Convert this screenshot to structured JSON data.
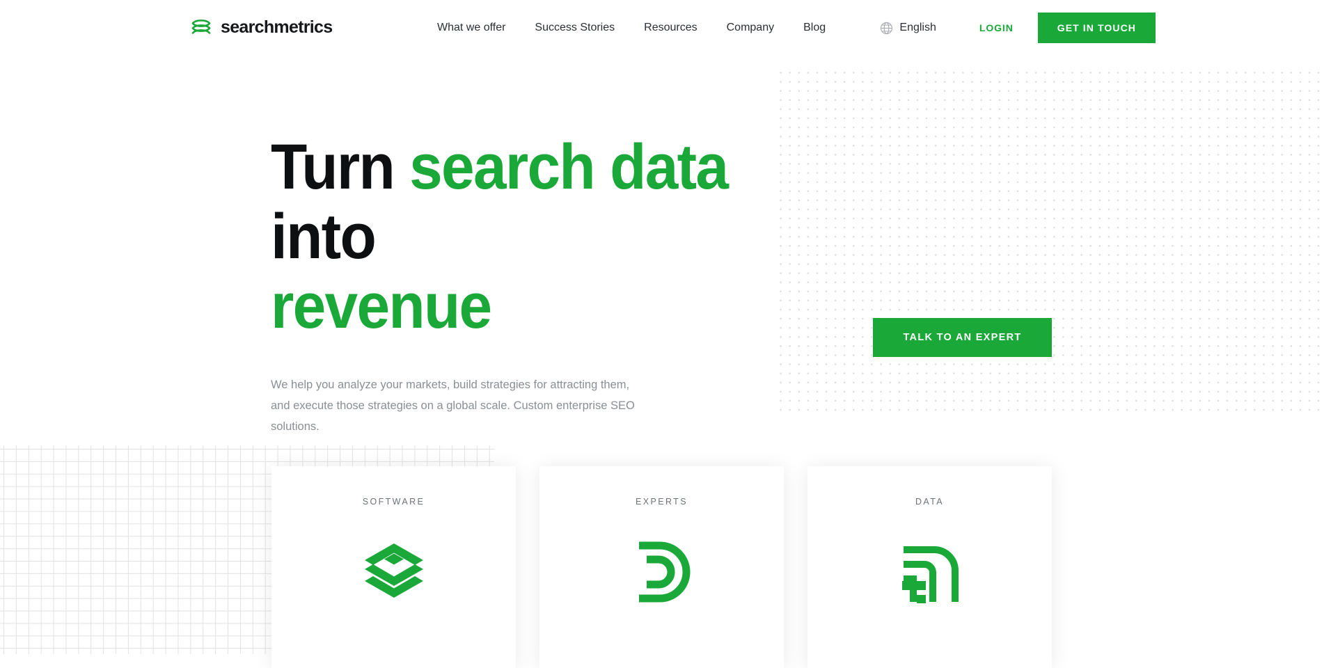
{
  "brand": {
    "name": "searchmetrics",
    "logo_icon": "stacked-layers-icon",
    "color": "#1aa838"
  },
  "header": {
    "nav_items": [
      {
        "label": "What we offer"
      },
      {
        "label": "Success Stories"
      },
      {
        "label": "Resources"
      },
      {
        "label": "Company"
      },
      {
        "label": "Blog"
      }
    ],
    "language": {
      "label": "English",
      "icon": "globe-icon"
    },
    "login_label": "LOGIN",
    "cta_label": "GET IN TOUCH"
  },
  "hero": {
    "title_part1": "Turn ",
    "title_accent1": "search data",
    "title_part2": " into",
    "title_accent2": "revenue",
    "subtitle": "We help you analyze your markets, build strategies for attracting them, and execute those strategies on a global scale. Custom enterprise SEO solutions.",
    "expert_button_label": "TALK TO AN EXPERT"
  },
  "cards": [
    {
      "label": "SOFTWARE",
      "icon": "layers-stack-icon"
    },
    {
      "label": "EXPERTS",
      "icon": "concentric-arcs-icon"
    },
    {
      "label": "DATA",
      "icon": "signal-bars-icon"
    }
  ],
  "colors": {
    "brand_green": "#1aa838",
    "heading_dark": "#0d0f11",
    "body_gray": "#8a8f94",
    "dot_gray": "#dcdcde"
  }
}
